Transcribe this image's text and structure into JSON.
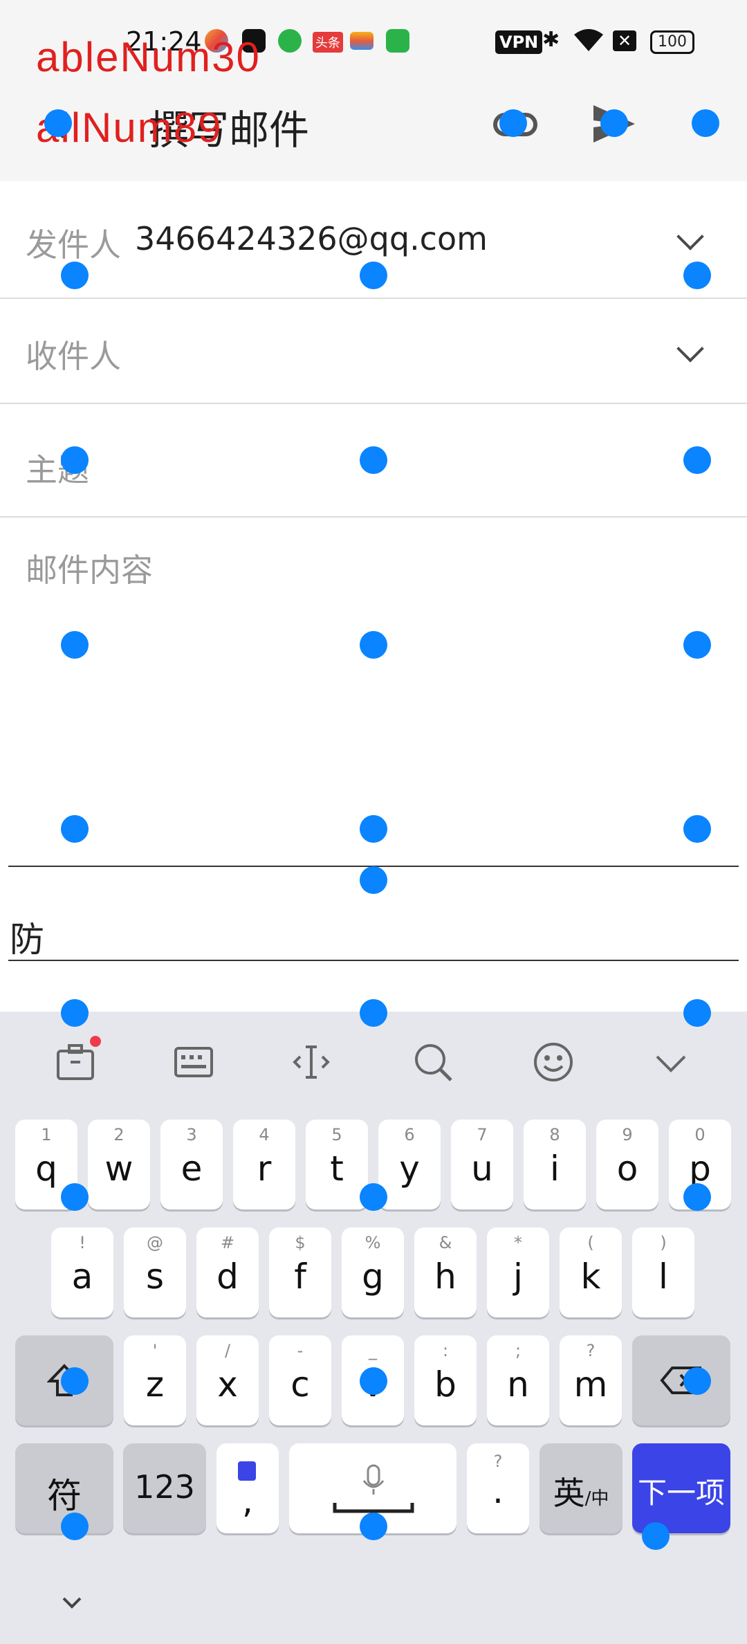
{
  "status_bar": {
    "time": "21:24",
    "app_badges": [
      "头条"
    ],
    "vpn": "VPN",
    "battery": "100"
  },
  "toolbar": {
    "title": "撰写邮件",
    "icons": [
      "back-arrow-icon",
      "attachment-icon",
      "send-icon",
      "more-icon"
    ]
  },
  "form": {
    "from_label": "发件人",
    "from_value": "3466424326@qq.com",
    "to_label": "收件人",
    "subject_placeholder": "主题",
    "body_placeholder": "邮件内容"
  },
  "input_field": {
    "value": "防"
  },
  "keyboard": {
    "row1": [
      {
        "k": "q",
        "h": "1"
      },
      {
        "k": "w",
        "h": "2"
      },
      {
        "k": "e",
        "h": "3"
      },
      {
        "k": "r",
        "h": "4"
      },
      {
        "k": "t",
        "h": "5"
      },
      {
        "k": "y",
        "h": "6"
      },
      {
        "k": "u",
        "h": "7"
      },
      {
        "k": "i",
        "h": "8"
      },
      {
        "k": "o",
        "h": "9"
      },
      {
        "k": "p",
        "h": "0"
      }
    ],
    "row2": [
      {
        "k": "a",
        "h": "!"
      },
      {
        "k": "s",
        "h": "@"
      },
      {
        "k": "d",
        "h": "#"
      },
      {
        "k": "f",
        "h": "$"
      },
      {
        "k": "g",
        "h": "%"
      },
      {
        "k": "h",
        "h": "&"
      },
      {
        "k": "j",
        "h": "*"
      },
      {
        "k": "k",
        "h": "("
      },
      {
        "k": "l",
        "h": ")"
      }
    ],
    "row3": [
      {
        "k": "z",
        "h": "'"
      },
      {
        "k": "x",
        "h": "/"
      },
      {
        "k": "c",
        "h": "-"
      },
      {
        "k": "v",
        "h": "_"
      },
      {
        "k": "b",
        "h": ":"
      },
      {
        "k": "n",
        "h": ";"
      },
      {
        "k": "m",
        "h": "?"
      }
    ],
    "symbols_key": "符",
    "numbers_key": "123",
    "comma_key": ",",
    "period_key": ".",
    "period_hint": "?",
    "lang_key_main": "英",
    "lang_key_sub": "/中",
    "next_key": "下一项"
  },
  "overlay": {
    "line1": "ableNum30",
    "line2": "allNum89"
  },
  "colors": {
    "accent_blue": "#3b44e6",
    "dot_blue": "#0a84ff",
    "overlay_red": "#e0201e"
  }
}
